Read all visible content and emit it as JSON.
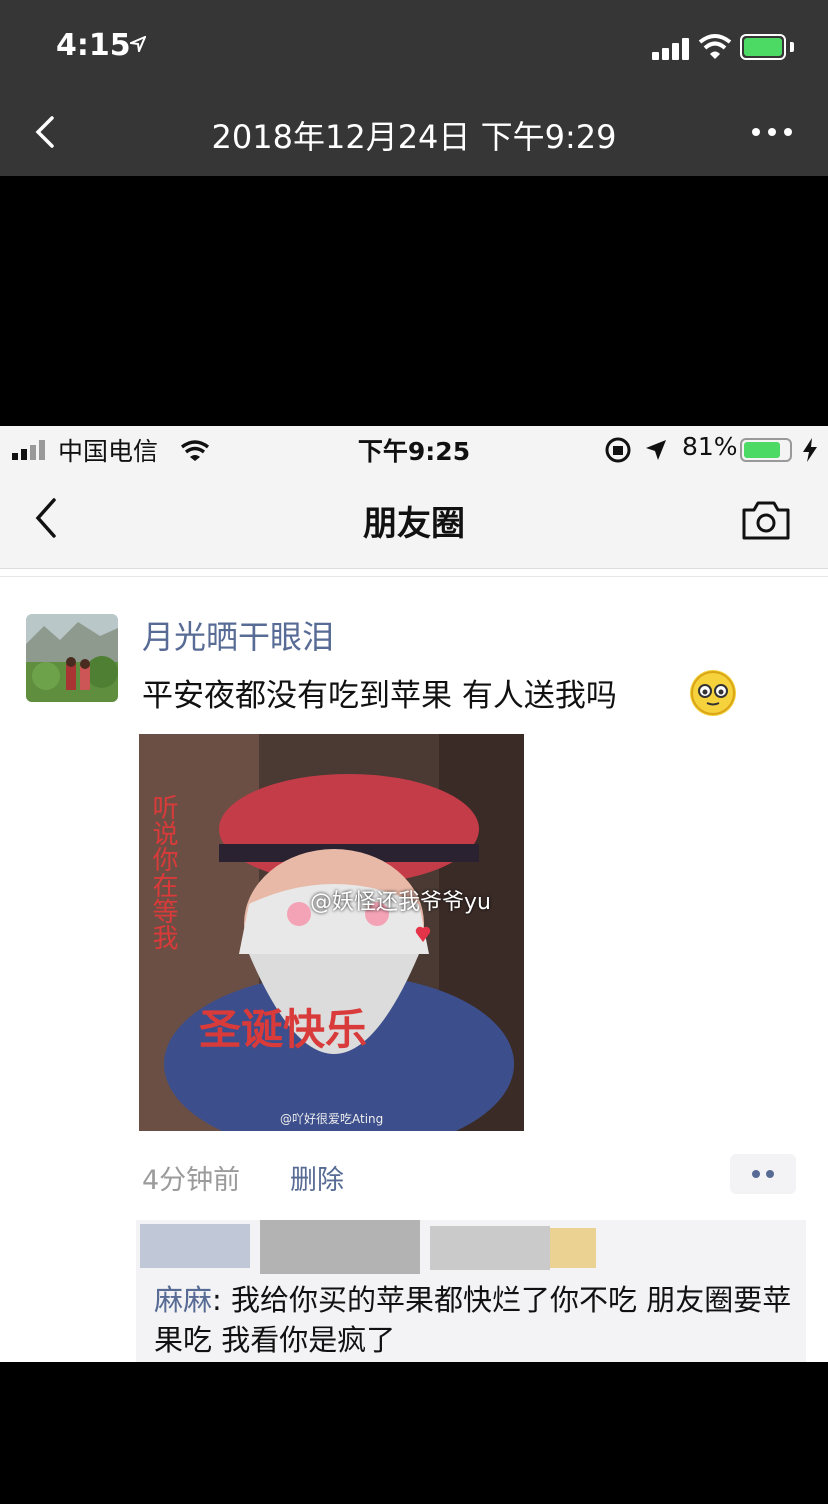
{
  "outer": {
    "time": "4:15",
    "title": "2018年12月24日 下午9:29"
  },
  "inner": {
    "carrier": "中国电信",
    "time": "下午9:25",
    "battery_pct": "81%",
    "battery_level": 0.81,
    "nav_title": "朋友圈"
  },
  "post": {
    "author": "月光晒干眼泪",
    "text": "平安夜都没有吃到苹果 有人送我吗",
    "image_watermark": "@妖怪还我爷爷yu",
    "image_watermark_small": "@吖好很爱吃Ating",
    "image_caption_side": "听说你在等我",
    "image_caption_bottom": "圣诞快乐",
    "time_ago": "4分钟前",
    "delete_label": "删除"
  },
  "comment": {
    "author": "麻麻",
    "text": "我给你买的苹果都快烂了你不吃 朋友圈要苹果吃 我看你是疯了"
  },
  "icons": {
    "outer_back": "chevron-left-icon",
    "outer_more": "more-icon",
    "inner_back": "chevron-left-icon",
    "camera": "camera-icon"
  }
}
